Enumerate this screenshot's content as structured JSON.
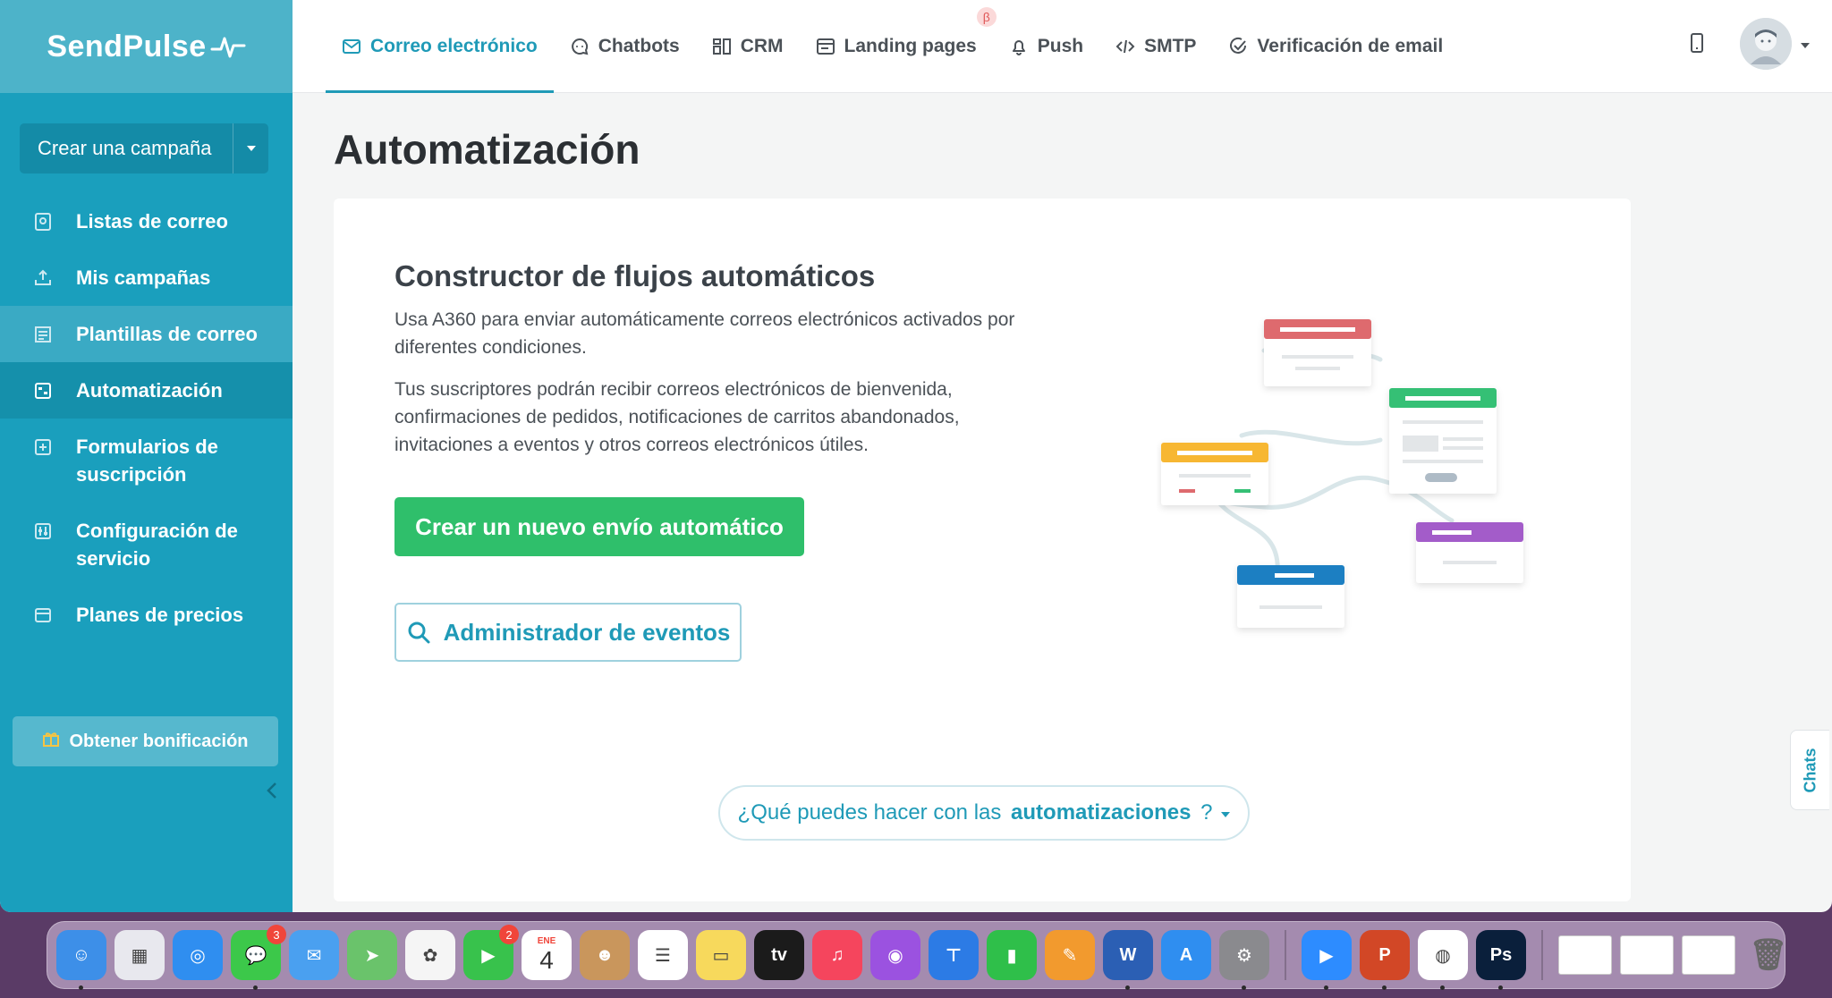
{
  "brand": {
    "logo_text": "SendPulse"
  },
  "sidebar": {
    "create_button": "Crear una campaña",
    "items": [
      {
        "label": "Listas de correo",
        "icon": "contact-book-icon",
        "state": "normal"
      },
      {
        "label": "Mis campañas",
        "icon": "send-tray-icon",
        "state": "normal"
      },
      {
        "label": "Plantillas de correo",
        "icon": "template-icon",
        "state": "hover"
      },
      {
        "label": "Automatización",
        "icon": "automation-icon",
        "state": "active"
      },
      {
        "label": "Formularios de suscripción",
        "icon": "form-icon",
        "state": "normal"
      },
      {
        "label": "Configuración de servicio",
        "icon": "settings-sliders-icon",
        "state": "normal"
      },
      {
        "label": "Planes de precios",
        "icon": "wallet-icon",
        "state": "normal"
      }
    ],
    "bonus_button": "Obtener bonificación"
  },
  "topnav": {
    "tabs": [
      {
        "label": "Correo electrónico",
        "icon": "email-icon",
        "active": true
      },
      {
        "label": "Chatbots",
        "icon": "chat-bubble-icon",
        "active": false
      },
      {
        "label": "CRM",
        "icon": "crm-board-icon",
        "active": false
      },
      {
        "label": "Landing pages",
        "icon": "landing-page-icon",
        "active": false,
        "badge": "β"
      },
      {
        "label": "Push",
        "icon": "bell-icon",
        "active": false
      },
      {
        "label": "SMTP",
        "icon": "code-icon",
        "active": false
      },
      {
        "label": "Verificación de email",
        "icon": "check-circle-icon",
        "active": false
      }
    ]
  },
  "main": {
    "page_title": "Automatización",
    "card": {
      "heading": "Constructor de flujos automáticos",
      "paragraph1": "Usa A360 para enviar automáticamente correos electrónicos activados por diferentes condiciones.",
      "paragraph2": "Tus suscriptores podrán recibir correos electrónicos de bienvenida, confirmaciones de pedidos, notificaciones de carritos abandonados, invitaciones a eventos y otros correos electrónicos útiles.",
      "primary_button": "Crear un nuevo envío automático",
      "secondary_button": "Administrador de eventos",
      "faq_prefix": "¿Qué puedes hacer con las ",
      "faq_bold": "automatizaciones",
      "faq_suffix": " ?"
    },
    "chats_tab": "Chats"
  },
  "dock": {
    "apps": [
      {
        "name": "finder",
        "color": "#3d8fe8",
        "glyph": "☺",
        "running": true
      },
      {
        "name": "launchpad",
        "color": "#e8e8ee",
        "glyph": "▦",
        "running": false
      },
      {
        "name": "safari",
        "color": "#2f8ef0",
        "glyph": "◎",
        "running": false
      },
      {
        "name": "messages",
        "color": "#3cc84a",
        "glyph": "💬",
        "running": true,
        "badge": "3"
      },
      {
        "name": "mail",
        "color": "#4aa0f0",
        "glyph": "✉",
        "running": false
      },
      {
        "name": "maps",
        "color": "#6ac36b",
        "glyph": "➤",
        "running": false
      },
      {
        "name": "photos",
        "color": "#f5f5f5",
        "glyph": "✿",
        "running": false
      },
      {
        "name": "facetime",
        "color": "#38c24c",
        "glyph": "▶",
        "running": false,
        "badge": "2"
      },
      {
        "name": "calendar",
        "color": "#ffffff",
        "glyph": "4",
        "running": false,
        "month": "ENE"
      },
      {
        "name": "contacts",
        "color": "#c9965c",
        "glyph": "☻",
        "running": false
      },
      {
        "name": "reminders",
        "color": "#ffffff",
        "glyph": "☰",
        "running": false
      },
      {
        "name": "notes",
        "color": "#f7d95c",
        "glyph": "▭",
        "running": false
      },
      {
        "name": "apple-tv",
        "color": "#1b1b1b",
        "glyph": "tv",
        "running": false
      },
      {
        "name": "music",
        "color": "#f5455d",
        "glyph": "♫",
        "running": false
      },
      {
        "name": "podcasts",
        "color": "#9b52e0",
        "glyph": "◉",
        "running": false
      },
      {
        "name": "keynote",
        "color": "#2c7be5",
        "glyph": "⊤",
        "running": false
      },
      {
        "name": "numbers",
        "color": "#2fbf4a",
        "glyph": "▮",
        "running": false
      },
      {
        "name": "pages",
        "color": "#f29a2e",
        "glyph": "✎",
        "running": false
      },
      {
        "name": "word",
        "color": "#2b5fb4",
        "glyph": "W",
        "running": true
      },
      {
        "name": "app-store",
        "color": "#2f8ef0",
        "glyph": "A",
        "running": false
      },
      {
        "name": "system-preferences",
        "color": "#8a8a8e",
        "glyph": "⚙",
        "running": true
      },
      {
        "name": "zoom",
        "color": "#2d8cff",
        "glyph": "▶",
        "running": true
      },
      {
        "name": "powerpoint",
        "color": "#d24726",
        "glyph": "P",
        "running": true
      },
      {
        "name": "chrome",
        "color": "#ffffff",
        "glyph": "◍",
        "running": true
      },
      {
        "name": "photoshop",
        "color": "#0a1f3b",
        "glyph": "Ps",
        "running": true
      }
    ]
  }
}
